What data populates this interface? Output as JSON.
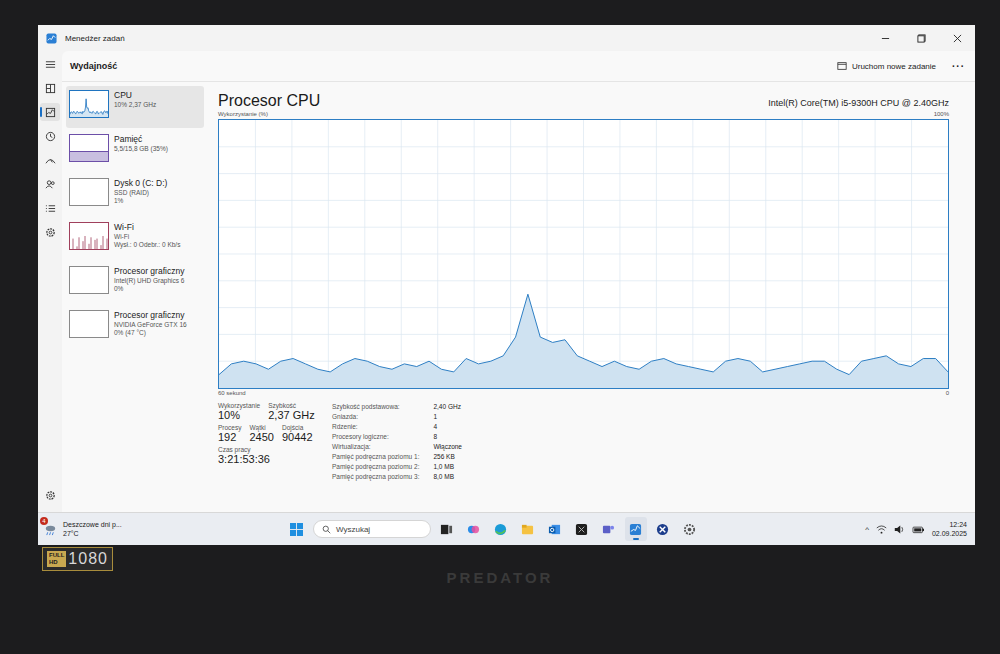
{
  "window": {
    "title": "Menedżer zadań"
  },
  "nav_items": [
    {
      "kind": "menu",
      "selected": false
    },
    {
      "kind": "processes",
      "selected": false
    },
    {
      "kind": "performance",
      "selected": true
    },
    {
      "kind": "history",
      "selected": false
    },
    {
      "kind": "startup",
      "selected": false
    },
    {
      "kind": "users",
      "selected": false
    },
    {
      "kind": "details",
      "selected": false
    },
    {
      "kind": "services",
      "selected": false
    }
  ],
  "header": {
    "title": "Wydajność",
    "run_task": "Uruchom nowe zadanie",
    "more": "···"
  },
  "sidebar": [
    {
      "name": "CPU",
      "lines": [
        "10% 2,37 GHz"
      ],
      "kind": "line",
      "selected": true,
      "values": [
        5,
        9,
        10,
        9,
        7,
        10,
        11,
        9,
        7,
        6,
        9,
        11,
        10,
        8,
        7,
        9,
        8,
        10,
        7,
        6,
        11,
        9,
        10,
        12,
        19,
        35,
        19,
        17,
        18,
        12,
        10,
        8,
        10,
        8,
        7,
        10,
        11,
        9,
        8,
        7,
        6,
        10,
        11,
        10,
        6,
        7,
        8,
        9,
        10,
        10,
        7,
        5,
        10,
        11,
        12,
        9,
        8,
        11,
        11,
        6
      ]
    },
    {
      "name": "Pamięć",
      "lines": [
        "5,5/15,8 GB (35%)"
      ],
      "kind": "level",
      "selected": false,
      "level": 0.35
    },
    {
      "name": "Dysk 0 (C: D:)",
      "lines": [
        "SSD (RAID)",
        "1%"
      ],
      "kind": "empty",
      "selected": false
    },
    {
      "name": "Wi-Fi",
      "lines": [
        "Wi-Fi",
        "Wysł.: 0 Odebr.: 0 Kb/s"
      ],
      "kind": "bars",
      "selected": false,
      "values": [
        0,
        40,
        0,
        10,
        45,
        0,
        30,
        50,
        0,
        20,
        45,
        0,
        35,
        40,
        0,
        15,
        50,
        0,
        40
      ]
    },
    {
      "name": "Procesor graficzny",
      "lines": [
        "Intel(R) UHD Graphics 6",
        "0%"
      ],
      "kind": "empty",
      "selected": false
    },
    {
      "name": "Procesor graficzny",
      "lines": [
        "NVIDIA GeForce GTX 16",
        "0% (47 °C)"
      ],
      "kind": "empty",
      "selected": false
    }
  ],
  "detail": {
    "title": "Procesor CPU",
    "model": "Intel(R) Core(TM) i5-9300H CPU @ 2.40GHz"
  },
  "chart": {
    "axis_label": "Wykorzystanie (%)",
    "max_label": "100%",
    "time_label": "60 sekund",
    "min_label": "0",
    "values": [
      5,
      9,
      10,
      9,
      7,
      10,
      11,
      9,
      7,
      6,
      9,
      11,
      10,
      8,
      7,
      9,
      8,
      10,
      7,
      6,
      11,
      9,
      10,
      12,
      19,
      35,
      19,
      17,
      18,
      12,
      10,
      8,
      10,
      8,
      7,
      10,
      11,
      9,
      8,
      7,
      6,
      10,
      11,
      10,
      6,
      7,
      8,
      9,
      10,
      10,
      7,
      5,
      10,
      11,
      12,
      9,
      8,
      11,
      11,
      6
    ]
  },
  "stats": [
    [
      {
        "label": "Wykorzystanie",
        "value": "10%"
      },
      {
        "label": "Szybkość",
        "value": "2,37 GHz"
      }
    ],
    [
      {
        "label": "Procesy",
        "value": "192"
      },
      {
        "label": "Wątki",
        "value": "2450"
      },
      {
        "label": "Dojścia",
        "value": "90442"
      }
    ],
    [
      {
        "label": "Czas pracy",
        "value": "3:21:53:36"
      }
    ]
  ],
  "specs": [
    {
      "label": "Szybkość podstawowa:",
      "value": "2,40 GHz"
    },
    {
      "label": "Gniazda:",
      "value": "1"
    },
    {
      "label": "Rdzenie:",
      "value": "4"
    },
    {
      "label": "Procesory logiczne:",
      "value": "8"
    },
    {
      "label": "Wirtualizacja:",
      "value": "Włączone"
    },
    {
      "label": "Pamięć podręczna poziomu 1:",
      "value": "256 KB"
    },
    {
      "label": "Pamięć podręczna poziomu 2:",
      "value": "1,0 MB"
    },
    {
      "label": "Pamięć podręczna poziomu 3:",
      "value": "8,0 MB"
    }
  ],
  "taskbar": {
    "widget": {
      "badge": "4",
      "text": "Deszczowe dni p...",
      "temp": "27°C"
    },
    "search": "Wyszukaj",
    "apps": [
      {
        "kind": "taskview",
        "selected": false
      },
      {
        "kind": "copilot",
        "selected": false
      },
      {
        "kind": "edge",
        "selected": false
      },
      {
        "kind": "explorer",
        "selected": false
      },
      {
        "kind": "outlook",
        "selected": false
      },
      {
        "kind": "dark",
        "selected": false
      },
      {
        "kind": "teams",
        "selected": false
      },
      {
        "kind": "taskmgr",
        "selected": true
      },
      {
        "kind": "xbox",
        "selected": false
      },
      {
        "kind": "settings",
        "selected": false
      }
    ],
    "chevron": "^",
    "time": "12:24",
    "date": "02.09.2025"
  },
  "bezel": {
    "sticker_top": "FULL",
    "sticker_bottom": "HD",
    "sticker_res": "1080",
    "logo": "PREDATOR"
  }
}
